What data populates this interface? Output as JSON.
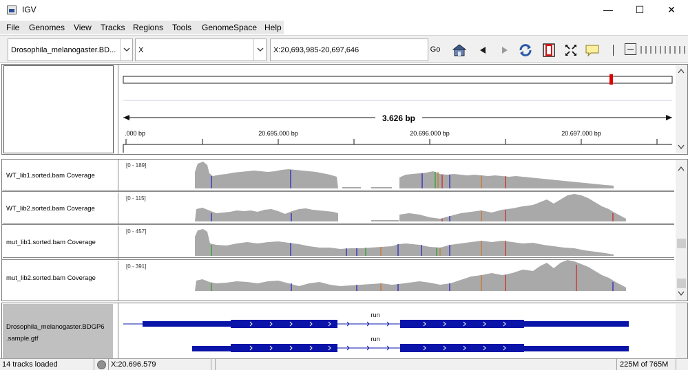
{
  "window": {
    "title": "IGV",
    "minimize_glyph": "—",
    "maximize_glyph": "☐",
    "close_glyph": "✕"
  },
  "menu": {
    "items": [
      "File",
      "Genomes",
      "View",
      "Tracks",
      "Regions",
      "Tools",
      "GenomeSpace",
      "Help"
    ]
  },
  "toolbar": {
    "genome_value": "Drosophila_melanogaster.BD...",
    "chromosome_value": "X",
    "locus_value": "X:20,693,985-20,697,646",
    "go_label": "Go",
    "icons": [
      "home-icon",
      "back-icon",
      "forward-icon",
      "refresh-icon",
      "region-of-interest-icon",
      "resize-tracks-icon",
      "popup-info-icon",
      "zoom-out-icon",
      "zoom-slider-icon"
    ]
  },
  "ruler": {
    "span_label": "3.626 bp",
    "tick_labels": [
      ".000 bp",
      "20.695.000 bp",
      "20.696.000 bp",
      "20.697.000 bp"
    ]
  },
  "tracks": [
    {
      "name": "WT_lib1.sorted.bam Coverage",
      "range": "[0 - 189]"
    },
    {
      "name": "WT_lib2.sorted.bam Coverage",
      "range": "[0 - 115]"
    },
    {
      "name": "mut_lib1.sorted.bam Coverage",
      "range": "[0 - 457]"
    },
    {
      "name": "mut_lib2.sorted.bam Coverage",
      "range": "[0 - 391]"
    }
  ],
  "feature_track": {
    "name_line1": "Drosophila_melanogaster.BDGP6",
    "name_line2": ".sample.gtf",
    "gene_label_1": "run",
    "gene_label_2": "run"
  },
  "status": {
    "tracks_loaded": "14 tracks loaded",
    "position": "X:20.696.579",
    "memory": "225M of 765M"
  },
  "colors": {
    "coverage": "#a9a9a9",
    "feature": "#0a14a8",
    "roi_marker": "#e00000",
    "name_panel_gray": "#c0c0c0"
  }
}
